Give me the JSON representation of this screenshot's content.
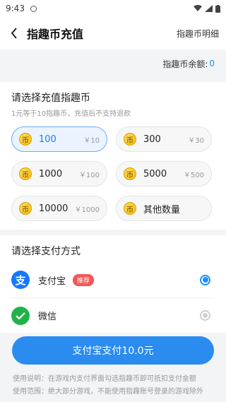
{
  "status": {
    "time": "9:43"
  },
  "header": {
    "title": "指趣币充值",
    "right_link": "指趣币明细"
  },
  "balance": {
    "label": "指趣币余额:",
    "value": "0"
  },
  "recharge": {
    "title": "请选择充值指趣币",
    "subtitle": "1元等于10指趣币，充值后不支持退款",
    "coin_glyph": "币",
    "options": [
      {
        "amount": "100",
        "price": "￥10",
        "selected": true
      },
      {
        "amount": "300",
        "price": "￥30",
        "selected": false
      },
      {
        "amount": "1000",
        "price": "￥100",
        "selected": false
      },
      {
        "amount": "5000",
        "price": "￥500",
        "selected": false
      },
      {
        "amount": "10000",
        "price": "￥1000",
        "selected": false
      },
      {
        "amount": "其他数量",
        "price": "",
        "selected": false
      }
    ]
  },
  "payment": {
    "title": "请选择支付方式",
    "methods": [
      {
        "name": "支付宝",
        "badge": "推荐",
        "icon": "alipay-icon",
        "icon_glyph": "支",
        "selected": true
      },
      {
        "name": "微信",
        "badge": "",
        "icon": "wechat-icon",
        "icon_glyph": "",
        "selected": false
      }
    ]
  },
  "pay_button": {
    "label": "支付宝支付10.0元"
  },
  "notes": [
    "使用说明：在游戏内支付界面勾选指趣币即可抵扣支付金额",
    "使用范围：绝大部分游戏，不能使用指趣账号登录的游戏除外"
  ],
  "colors": {
    "accent": "#2b8cf0",
    "badge": "#f25757",
    "alipay": "#1677ff",
    "wechat": "#21b24a"
  }
}
